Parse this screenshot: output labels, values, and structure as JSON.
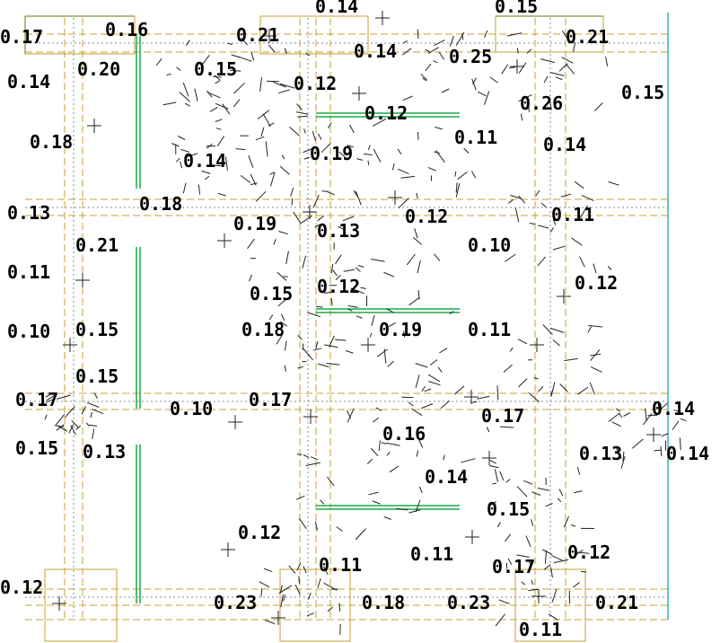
{
  "drawing": {
    "labels": [
      "0.14",
      "0.15",
      "0.17",
      "0.16",
      "0.21",
      "0.21",
      "0.14",
      "0.25",
      "0.14",
      "0.20",
      "0.15",
      "0.12",
      "0.15",
      "0.12",
      "0.26",
      "0.18",
      "0.11",
      "0.14",
      "0.19",
      "0.14",
      "0.18",
      "0.13",
      "0.12",
      "0.11",
      "0.19",
      "0.21",
      "0.13",
      "0.10",
      "0.11",
      "0.15",
      "0.12",
      "0.12",
      "0.10",
      "0.15",
      "0.18",
      "0.19",
      "0.11",
      "0.15",
      "0.17",
      "0.10",
      "0.17",
      "0.14",
      "0.16",
      "0.17",
      "0.15",
      "0.13",
      "0.13",
      "0.14",
      "0.14",
      "0.15",
      "0.12",
      "0.11",
      "0.12",
      "0.11",
      "0.17",
      "0.12",
      "0.23",
      "0.18",
      "0.23",
      "0.21",
      "0.11"
    ],
    "colors": {
      "grid": "#c8a030",
      "beam": "#1aa84a",
      "edge": "#2ab8b0",
      "axis": "#8a8a8a",
      "mark": "#222222"
    }
  }
}
